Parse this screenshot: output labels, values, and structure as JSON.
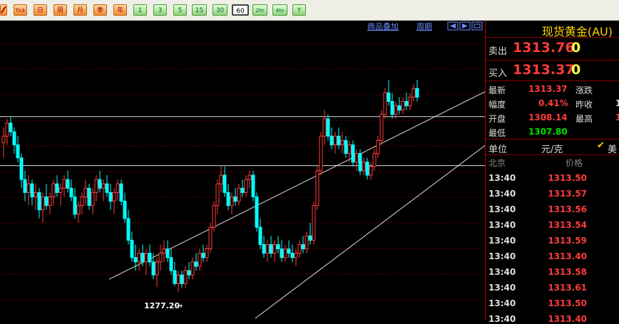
{
  "colors": {
    "up": "#ff3c3c",
    "down": "#00ffff",
    "line": "#ffffff",
    "grid": "#8b0000",
    "accent": "#ffd200"
  },
  "toolbar": {
    "buttons": [
      {
        "icon": "pencil-icon"
      },
      {
        "label": "Tick"
      },
      {
        "label": "日"
      },
      {
        "label": "周"
      },
      {
        "label": "月"
      },
      {
        "label": "季"
      },
      {
        "label": "年"
      },
      {
        "label": "1"
      },
      {
        "label": "3"
      },
      {
        "label": "5"
      },
      {
        "label": "15"
      },
      {
        "label": "30"
      },
      {
        "label": "60"
      },
      {
        "label": "2hr"
      },
      {
        "label": "4hr"
      },
      {
        "label": "Y"
      }
    ]
  },
  "chart_header": {
    "overlay_link": "商品叠加",
    "period_link": "周期"
  },
  "chart_data": {
    "type": "candlestick",
    "annotation": {
      "label": "1277.20",
      "value": 1277.2
    },
    "ylim": [
      1270,
      1336
    ],
    "horizontal_levels": [
      1316.5,
      1305.2
    ],
    "trend_channel": {
      "upper": {
        "from": [
          30,
          1279
        ],
        "to": [
          147,
          1327
        ]
      },
      "lower": {
        "from": [
          71,
          1270
        ],
        "to": [
          147,
          1317
        ]
      }
    },
    "candles": [
      [
        1310.5,
        1314.0,
        1307.0,
        1312.0
      ],
      [
        1312.0,
        1316.0,
        1310.0,
        1315.0
      ],
      [
        1315.0,
        1316.5,
        1312.0,
        1313.0
      ],
      [
        1313.0,
        1314.0,
        1308.0,
        1310.0
      ],
      [
        1310.0,
        1312.0,
        1306.0,
        1307.0
      ],
      [
        1307.0,
        1308.0,
        1300.0,
        1302.0
      ],
      [
        1302.0,
        1304.0,
        1297.0,
        1299.0
      ],
      [
        1299.0,
        1303.0,
        1296.0,
        1301.0
      ],
      [
        1301.0,
        1302.0,
        1296.0,
        1298.0
      ],
      [
        1298.0,
        1301.0,
        1295.0,
        1299.0
      ],
      [
        1299.0,
        1300.0,
        1293.0,
        1295.0
      ],
      [
        1295.0,
        1299.0,
        1292.0,
        1298.0
      ],
      [
        1298.0,
        1301.0,
        1295.0,
        1296.0
      ],
      [
        1296.0,
        1299.0,
        1294.0,
        1298.0
      ],
      [
        1298.0,
        1302.0,
        1296.0,
        1301.0
      ],
      [
        1301.0,
        1303.0,
        1298.0,
        1299.0
      ],
      [
        1299.0,
        1301.0,
        1296.0,
        1300.0
      ],
      [
        1300.0,
        1303.0,
        1298.0,
        1302.0
      ],
      [
        1302.0,
        1304.0,
        1299.0,
        1300.0
      ],
      [
        1300.0,
        1302.0,
        1297.0,
        1298.0
      ],
      [
        1298.0,
        1300.0,
        1293.0,
        1294.0
      ],
      [
        1294.0,
        1297.0,
        1292.0,
        1296.0
      ],
      [
        1296.0,
        1299.0,
        1294.0,
        1298.0
      ],
      [
        1298.0,
        1302.0,
        1296.0,
        1300.0
      ],
      [
        1300.0,
        1301.0,
        1295.0,
        1296.0
      ],
      [
        1296.0,
        1300.0,
        1294.0,
        1299.0
      ],
      [
        1299.0,
        1303.0,
        1297.0,
        1302.0
      ],
      [
        1302.0,
        1304.0,
        1299.0,
        1300.0
      ],
      [
        1300.0,
        1302.0,
        1297.0,
        1301.0
      ],
      [
        1301.0,
        1303.0,
        1298.0,
        1299.0
      ],
      [
        1299.0,
        1301.0,
        1295.0,
        1297.0
      ],
      [
        1297.0,
        1300.0,
        1294.0,
        1299.0
      ],
      [
        1299.0,
        1302.0,
        1297.0,
        1301.0
      ],
      [
        1301.0,
        1302.0,
        1296.0,
        1297.0
      ],
      [
        1297.0,
        1299.0,
        1292.0,
        1293.0
      ],
      [
        1293.0,
        1295.0,
        1287.0,
        1288.0
      ],
      [
        1288.0,
        1290.0,
        1283.0,
        1284.0
      ],
      [
        1284.0,
        1287.0,
        1281.0,
        1283.0
      ],
      [
        1283.0,
        1286.0,
        1281.0,
        1285.0
      ],
      [
        1285.0,
        1287.0,
        1282.0,
        1283.0
      ],
      [
        1283.0,
        1286.0,
        1280.0,
        1285.0
      ],
      [
        1285.0,
        1287.0,
        1282.0,
        1283.0
      ],
      [
        1283.0,
        1285.0,
        1279.0,
        1280.0
      ],
      [
        1280.0,
        1284.0,
        1277.2,
        1283.0
      ],
      [
        1283.0,
        1287.0,
        1281.0,
        1285.0
      ],
      [
        1285.0,
        1288.0,
        1283.0,
        1286.0
      ],
      [
        1286.0,
        1288.0,
        1283.0,
        1284.0
      ],
      [
        1284.0,
        1286.0,
        1280.0,
        1281.0
      ],
      [
        1281.0,
        1283.0,
        1277.5,
        1278.0
      ],
      [
        1278.0,
        1281.0,
        1276.0,
        1280.0
      ],
      [
        1280.0,
        1281.0,
        1277.0,
        1278.0
      ],
      [
        1278.0,
        1282.0,
        1277.0,
        1281.0
      ],
      [
        1281.0,
        1283.0,
        1279.0,
        1280.0
      ],
      [
        1280.0,
        1284.0,
        1279.0,
        1283.0
      ],
      [
        1283.0,
        1285.0,
        1281.0,
        1282.0
      ],
      [
        1282.0,
        1286.0,
        1281.0,
        1285.0
      ],
      [
        1285.0,
        1287.0,
        1283.0,
        1284.0
      ],
      [
        1284.0,
        1287.0,
        1283.0,
        1286.0
      ],
      [
        1286.0,
        1292.0,
        1285.0,
        1291.0
      ],
      [
        1291.0,
        1297.0,
        1290.0,
        1296.0
      ],
      [
        1296.0,
        1302.0,
        1294.0,
        1301.0
      ],
      [
        1301.0,
        1305.0,
        1299.0,
        1303.0
      ],
      [
        1303.0,
        1305.0,
        1298.0,
        1299.0
      ],
      [
        1299.0,
        1301.0,
        1295.0,
        1296.0
      ],
      [
        1296.0,
        1299.0,
        1294.0,
        1298.0
      ],
      [
        1298.0,
        1300.0,
        1296.0,
        1297.0
      ],
      [
        1297.0,
        1301.0,
        1296.0,
        1300.0
      ],
      [
        1300.0,
        1302.0,
        1298.0,
        1299.0
      ],
      [
        1299.0,
        1303.0,
        1298.0,
        1302.0
      ],
      [
        1302.0,
        1304.0,
        1300.0,
        1303.0
      ],
      [
        1303.0,
        1304.0,
        1297.0,
        1298.0
      ],
      [
        1298.0,
        1299.0,
        1290.0,
        1291.0
      ],
      [
        1291.0,
        1293.0,
        1286.0,
        1287.0
      ],
      [
        1287.0,
        1289.0,
        1284.0,
        1285.0
      ],
      [
        1285.0,
        1288.0,
        1283.0,
        1287.0
      ],
      [
        1287.0,
        1289.0,
        1284.0,
        1285.0
      ],
      [
        1285.0,
        1288.0,
        1283.0,
        1287.0
      ],
      [
        1287.0,
        1289.0,
        1285.0,
        1286.0
      ],
      [
        1286.0,
        1288.0,
        1283.0,
        1284.0
      ],
      [
        1284.0,
        1287.0,
        1283.0,
        1286.0
      ],
      [
        1286.0,
        1288.0,
        1284.0,
        1285.0
      ],
      [
        1285.0,
        1287.0,
        1283.0,
        1284.0
      ],
      [
        1284.0,
        1286.0,
        1282.0,
        1285.0
      ],
      [
        1285.0,
        1288.0,
        1284.0,
        1287.0
      ],
      [
        1287.0,
        1289.0,
        1285.0,
        1286.0
      ],
      [
        1286.0,
        1290.0,
        1285.0,
        1289.0
      ],
      [
        1289.0,
        1292.0,
        1287.0,
        1288.0
      ],
      [
        1288.0,
        1297.0,
        1287.0,
        1296.0
      ],
      [
        1296.0,
        1305.0,
        1295.0,
        1304.0
      ],
      [
        1304.0,
        1313.0,
        1303.0,
        1312.0
      ],
      [
        1312.0,
        1318.0,
        1310.0,
        1316.0
      ],
      [
        1316.0,
        1317.0,
        1311.0,
        1312.0
      ],
      [
        1312.0,
        1314.0,
        1309.0,
        1310.0
      ],
      [
        1310.0,
        1313.0,
        1308.0,
        1312.0
      ],
      [
        1312.0,
        1314.0,
        1309.0,
        1310.0
      ],
      [
        1310.0,
        1313.0,
        1308.0,
        1311.0
      ],
      [
        1311.0,
        1312.0,
        1307.0,
        1308.0
      ],
      [
        1308.0,
        1311.0,
        1306.0,
        1310.0
      ],
      [
        1310.0,
        1311.0,
        1305.0,
        1306.0
      ],
      [
        1306.0,
        1309.0,
        1304.0,
        1308.0
      ],
      [
        1308.0,
        1309.0,
        1303.0,
        1304.0
      ],
      [
        1304.0,
        1307.0,
        1303.0,
        1306.0
      ],
      [
        1306.0,
        1307.0,
        1302.0,
        1303.0
      ],
      [
        1303.0,
        1306.0,
        1302.0,
        1305.0
      ],
      [
        1305.0,
        1309.0,
        1304.0,
        1308.0
      ],
      [
        1308.0,
        1312.0,
        1307.0,
        1311.0
      ],
      [
        1311.0,
        1318.0,
        1310.0,
        1317.0
      ],
      [
        1317.0,
        1323.0,
        1316.0,
        1322.0
      ],
      [
        1322.0,
        1325.0,
        1319.0,
        1320.0
      ],
      [
        1320.0,
        1322.0,
        1316.0,
        1317.0
      ],
      [
        1317.0,
        1320.0,
        1316.0,
        1319.0
      ],
      [
        1319.0,
        1321.0,
        1317.0,
        1318.0
      ],
      [
        1318.0,
        1321.0,
        1317.0,
        1320.0
      ],
      [
        1320.0,
        1322.0,
        1318.0,
        1319.0
      ],
      [
        1319.0,
        1322.0,
        1318.0,
        1321.0
      ],
      [
        1321.0,
        1324.0,
        1320.0,
        1323.0
      ],
      [
        1323.0,
        1325.0,
        1320.0,
        1321.0
      ]
    ]
  },
  "right_panel": {
    "title": "现货黄金(AU)",
    "sell": {
      "label": "卖出",
      "price": "1313.76",
      "vol": "0"
    },
    "buy": {
      "label": "买入",
      "price": "1313.37",
      "vol": "0"
    },
    "quote": {
      "latest_label": "最新",
      "latest": "1313.37",
      "change_label": "涨跌",
      "amplitude_label": "幅度",
      "amplitude": "0.41%",
      "prev_close_label": "昨收",
      "prev_close": "1",
      "open_label": "开盘",
      "open": "1308.14",
      "high_label": "最高",
      "high": "1",
      "low_label": "最低",
      "low": "1307.80"
    },
    "unit_label": "单位",
    "unit_value": "元/克",
    "currency_partial": "美",
    "ticks_header": {
      "time": "北京",
      "price": "价格"
    },
    "ticks": [
      {
        "time": "13:40",
        "price": "1313.50"
      },
      {
        "time": "13:40",
        "price": "1313.57"
      },
      {
        "time": "13:40",
        "price": "1313.56"
      },
      {
        "time": "13:40",
        "price": "1313.54"
      },
      {
        "time": "13:40",
        "price": "1313.59"
      },
      {
        "time": "13:40",
        "price": "1313.40"
      },
      {
        "time": "13:40",
        "price": "1313.58"
      },
      {
        "time": "13:40",
        "price": "1313.61"
      },
      {
        "time": "13:40",
        "price": "1313.50"
      },
      {
        "time": "13:40",
        "price": "1313.40"
      }
    ]
  }
}
